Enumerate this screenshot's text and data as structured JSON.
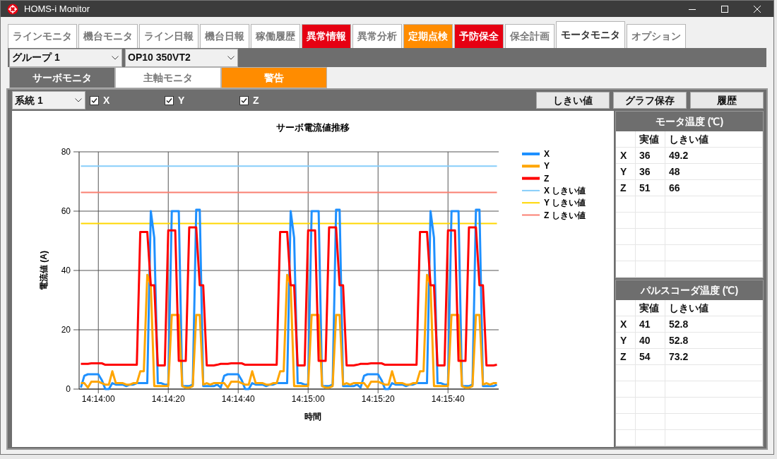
{
  "window": {
    "title": "HOMS-i Monitor"
  },
  "tabs": [
    {
      "label": "ラインモニタ",
      "kind": "normal",
      "selected": false
    },
    {
      "label": "機台モニタ",
      "kind": "normal",
      "selected": false
    },
    {
      "label": "ライン日報",
      "kind": "normal",
      "selected": false
    },
    {
      "label": "機台日報",
      "kind": "normal",
      "selected": false
    },
    {
      "label": "稼働履歴",
      "kind": "normal",
      "selected": false
    },
    {
      "label": "異常情報",
      "kind": "alert",
      "selected": false
    },
    {
      "label": "異常分析",
      "kind": "normal",
      "selected": false
    },
    {
      "label": "定期点検",
      "kind": "warning",
      "selected": false
    },
    {
      "label": "予防保全",
      "kind": "alert",
      "selected": false
    },
    {
      "label": "保全計画",
      "kind": "normal",
      "selected": false
    },
    {
      "label": "モータモニタ",
      "kind": "normal",
      "selected": true
    },
    {
      "label": "オプション",
      "kind": "normal",
      "selected": false
    }
  ],
  "selectors": [
    {
      "value": "グループ 1"
    },
    {
      "value": "OP10 350VT2"
    }
  ],
  "sub_tabs": [
    {
      "label": "サーボモニタ",
      "kind": "normal",
      "selected": true
    },
    {
      "label": "主軸モニタ",
      "kind": "normal",
      "selected": false
    },
    {
      "label": "警告",
      "kind": "warning",
      "selected": false
    }
  ],
  "toolbar": {
    "system_select": "系統 1",
    "axes": [
      {
        "label": "X",
        "checked": true
      },
      {
        "label": "Y",
        "checked": true
      },
      {
        "label": "Z",
        "checked": true
      }
    ],
    "buttons": [
      "しきい値",
      "グラフ保存",
      "履歴"
    ]
  },
  "chart": {
    "chart_data": {
      "type": "line",
      "title": "サーボ電流値推移",
      "xlabel": "時間",
      "ylabel": "電流値 (A)",
      "categories": [
        null,
        null,
        null,
        null,
        null,
        "14:14:00",
        null,
        null,
        null,
        null,
        null,
        null,
        null,
        null,
        null,
        null,
        null,
        null,
        null,
        null,
        null,
        null,
        null,
        null,
        null,
        "14:14:20",
        null,
        null,
        null,
        null,
        null,
        null,
        null,
        null,
        null,
        null,
        null,
        null,
        null,
        null,
        null,
        null,
        null,
        null,
        null,
        "14:14:40",
        null,
        null,
        null,
        null,
        null,
        null,
        null,
        null,
        null,
        null,
        null,
        null,
        null,
        null,
        null,
        null,
        null,
        null,
        null,
        "14:15:00",
        null,
        null,
        null,
        null,
        null,
        null,
        null,
        null,
        null,
        null,
        null,
        null,
        null,
        null,
        null,
        null,
        null,
        null,
        null,
        "14:15:20",
        null,
        null,
        null,
        null,
        null,
        null,
        null,
        null,
        null,
        null,
        null,
        null,
        null,
        null,
        null,
        null,
        null,
        null,
        null,
        "14:15:40",
        null,
        null,
        null,
        null,
        null,
        null,
        null,
        null,
        null,
        null,
        null,
        null,
        null,
        null
      ],
      "series": [
        {
          "name": "X",
          "color": "#1e90ff",
          "values": [
            0.5,
            4.5,
            5,
            5,
            5,
            5,
            3,
            0,
            0,
            2,
            1.5,
            1.5,
            1.5,
            1,
            1.5,
            1.5,
            2,
            2,
            2,
            2,
            60,
            51,
            2,
            2,
            1.5,
            1.5,
            60,
            60,
            60,
            1,
            1,
            1,
            1.5,
            60.5,
            60.5,
            1,
            1,
            1,
            1,
            1.5,
            0.5,
            4.5,
            5,
            5,
            5,
            5,
            3,
            0,
            0,
            2,
            1.5,
            1.5,
            1.5,
            1,
            1.5,
            1.5,
            2,
            2,
            2,
            2,
            60,
            51,
            2,
            2,
            1.5,
            1.5,
            60,
            60,
            60,
            1,
            1,
            1,
            1.5,
            60.5,
            60.5,
            1,
            1,
            1,
            1,
            1.5,
            0.5,
            4.5,
            5,
            5,
            5,
            5,
            3,
            0,
            0,
            2,
            1.5,
            1.5,
            1.5,
            1,
            1.5,
            1.5,
            2,
            2,
            2,
            2,
            60,
            51,
            2,
            2,
            1.5,
            1.5,
            60,
            60,
            60,
            1,
            1,
            1,
            1.5,
            60.5,
            60.5,
            1,
            1,
            1,
            1,
            1.5
          ]
        },
        {
          "name": "Y",
          "color": "#ffa500",
          "values": [
            2,
            2,
            0.5,
            2.5,
            2.5,
            2.5,
            2,
            1.5,
            1.5,
            6,
            2,
            2,
            2,
            1.5,
            1.5,
            2,
            2,
            6,
            6,
            38.5,
            35,
            1,
            1,
            1,
            1,
            1,
            25,
            25,
            25,
            1,
            0.5,
            0.5,
            1,
            25,
            25,
            1.5,
            2,
            1.5,
            2,
            2,
            2,
            2,
            0.5,
            2.5,
            2.5,
            2.5,
            2,
            1.5,
            1.5,
            6,
            2,
            2,
            2,
            1.5,
            1.5,
            2,
            2,
            6,
            6,
            38.5,
            35,
            1,
            1,
            1,
            1,
            1,
            25,
            25,
            25,
            1,
            0.5,
            0.5,
            1,
            25,
            25,
            1.5,
            2,
            1.5,
            2,
            2,
            2,
            2,
            0.5,
            2.5,
            2.5,
            2.5,
            2,
            1.5,
            1.5,
            6,
            2,
            2,
            2,
            1.5,
            1.5,
            2,
            2,
            6,
            6,
            38.5,
            35,
            1,
            1,
            1,
            1,
            1,
            25,
            25,
            25,
            1,
            0.5,
            0.5,
            1,
            25,
            25,
            1.5,
            2,
            1.5,
            2,
            2
          ]
        },
        {
          "name": "Z",
          "color": "#ff0000",
          "values": [
            8.5,
            8.5,
            8.5,
            8.7,
            8.7,
            8.7,
            8.7,
            8.2,
            8.2,
            8.2,
            8.2,
            8.2,
            8.2,
            8.2,
            8.2,
            8.2,
            8.2,
            53,
            53,
            53,
            35,
            35,
            8,
            8,
            8,
            53.5,
            53.5,
            53.5,
            9.5,
            9.5,
            9.5,
            54.5,
            54.5,
            54.5,
            35,
            35,
            8,
            8,
            8,
            8.2,
            8.5,
            8.5,
            8.5,
            8.7,
            8.7,
            8.7,
            8.7,
            8.2,
            8.2,
            8.2,
            8.2,
            8.2,
            8.2,
            8.2,
            8.2,
            8.2,
            8.2,
            53,
            53,
            53,
            35,
            35,
            8,
            8,
            8,
            53.5,
            53.5,
            53.5,
            9.5,
            9.5,
            9.5,
            54.5,
            54.5,
            54.5,
            35,
            35,
            8,
            8,
            8,
            8.2,
            8.5,
            8.5,
            8.5,
            8.7,
            8.7,
            8.7,
            8.7,
            8.2,
            8.2,
            8.2,
            8.2,
            8.2,
            8.2,
            8.2,
            8.2,
            8.2,
            8.2,
            53,
            53,
            53,
            35,
            35,
            8,
            8,
            8,
            53.5,
            53.5,
            53.5,
            9.5,
            9.5,
            9.5,
            54.5,
            54.5,
            54.5,
            35,
            35,
            8,
            8,
            8,
            8.2
          ]
        },
        {
          "name": "X しきい値",
          "color": "#87cefa",
          "values": [
            75.2,
            75.2,
            75.2,
            75.2,
            75.2,
            75.2,
            75.2,
            75.2,
            75.2,
            75.2,
            75.2,
            75.2,
            75.2,
            75.2,
            75.2,
            75.2,
            75.2,
            75.2,
            75.2,
            75.2,
            75.2,
            75.2,
            75.2,
            75.2,
            75.2,
            75.2,
            75.2,
            75.2,
            75.2,
            75.2,
            75.2,
            75.2,
            75.2,
            75.2,
            75.2,
            75.2,
            75.2,
            75.2,
            75.2,
            75.2,
            75.2,
            75.2,
            75.2,
            75.2,
            75.2,
            75.2,
            75.2,
            75.2,
            75.2,
            75.2,
            75.2,
            75.2,
            75.2,
            75.2,
            75.2,
            75.2,
            75.2,
            75.2,
            75.2,
            75.2,
            75.2,
            75.2,
            75.2,
            75.2,
            75.2,
            75.2,
            75.2,
            75.2,
            75.2,
            75.2,
            75.2,
            75.2,
            75.2,
            75.2,
            75.2,
            75.2,
            75.2,
            75.2,
            75.2,
            75.2,
            75.2,
            75.2,
            75.2,
            75.2,
            75.2,
            75.2,
            75.2,
            75.2,
            75.2,
            75.2,
            75.2,
            75.2,
            75.2,
            75.2,
            75.2,
            75.2,
            75.2,
            75.2,
            75.2,
            75.2,
            75.2,
            75.2,
            75.2,
            75.2,
            75.2,
            75.2,
            75.2,
            75.2,
            75.2,
            75.2,
            75.2,
            75.2,
            75.2,
            75.2,
            75.2,
            75.2,
            75.2,
            75.2,
            75.2,
            75.2
          ]
        },
        {
          "name": "Y しきい値",
          "color": "#ffd700",
          "values": [
            55.8,
            55.8,
            55.8,
            55.8,
            55.8,
            55.8,
            55.8,
            55.8,
            55.8,
            55.8,
            55.8,
            55.8,
            55.8,
            55.8,
            55.8,
            55.8,
            55.8,
            55.8,
            55.8,
            55.8,
            55.8,
            55.8,
            55.8,
            55.8,
            55.8,
            55.8,
            55.8,
            55.8,
            55.8,
            55.8,
            55.8,
            55.8,
            55.8,
            55.8,
            55.8,
            55.8,
            55.8,
            55.8,
            55.8,
            55.8,
            55.8,
            55.8,
            55.8,
            55.8,
            55.8,
            55.8,
            55.8,
            55.8,
            55.8,
            55.8,
            55.8,
            55.8,
            55.8,
            55.8,
            55.8,
            55.8,
            55.8,
            55.8,
            55.8,
            55.8,
            55.8,
            55.8,
            55.8,
            55.8,
            55.8,
            55.8,
            55.8,
            55.8,
            55.8,
            55.8,
            55.8,
            55.8,
            55.8,
            55.8,
            55.8,
            55.8,
            55.8,
            55.8,
            55.8,
            55.8,
            55.8,
            55.8,
            55.8,
            55.8,
            55.8,
            55.8,
            55.8,
            55.8,
            55.8,
            55.8,
            55.8,
            55.8,
            55.8,
            55.8,
            55.8,
            55.8,
            55.8,
            55.8,
            55.8,
            55.8,
            55.8,
            55.8,
            55.8,
            55.8,
            55.8,
            55.8,
            55.8,
            55.8,
            55.8,
            55.8,
            55.8,
            55.8,
            55.8,
            55.8,
            55.8,
            55.8,
            55.8,
            55.8,
            55.8,
            55.8
          ]
        },
        {
          "name": "Z しきい値",
          "color": "#fa8072",
          "values": [
            66.3,
            66.3,
            66.3,
            66.3,
            66.3,
            66.3,
            66.3,
            66.3,
            66.3,
            66.3,
            66.3,
            66.3,
            66.3,
            66.3,
            66.3,
            66.3,
            66.3,
            66.3,
            66.3,
            66.3,
            66.3,
            66.3,
            66.3,
            66.3,
            66.3,
            66.3,
            66.3,
            66.3,
            66.3,
            66.3,
            66.3,
            66.3,
            66.3,
            66.3,
            66.3,
            66.3,
            66.3,
            66.3,
            66.3,
            66.3,
            66.3,
            66.3,
            66.3,
            66.3,
            66.3,
            66.3,
            66.3,
            66.3,
            66.3,
            66.3,
            66.3,
            66.3,
            66.3,
            66.3,
            66.3,
            66.3,
            66.3,
            66.3,
            66.3,
            66.3,
            66.3,
            66.3,
            66.3,
            66.3,
            66.3,
            66.3,
            66.3,
            66.3,
            66.3,
            66.3,
            66.3,
            66.3,
            66.3,
            66.3,
            66.3,
            66.3,
            66.3,
            66.3,
            66.3,
            66.3,
            66.3,
            66.3,
            66.3,
            66.3,
            66.3,
            66.3,
            66.3,
            66.3,
            66.3,
            66.3,
            66.3,
            66.3,
            66.3,
            66.3,
            66.3,
            66.3,
            66.3,
            66.3,
            66.3,
            66.3,
            66.3,
            66.3,
            66.3,
            66.3,
            66.3,
            66.3,
            66.3,
            66.3,
            66.3,
            66.3,
            66.3,
            66.3,
            66.3,
            66.3,
            66.3,
            66.3,
            66.3,
            66.3,
            66.3,
            66.3
          ]
        }
      ],
      "ylim": [
        0,
        80
      ],
      "grid": true,
      "legend": true,
      "yticks": [
        0,
        20,
        40,
        60,
        80
      ]
    }
  },
  "temperature_tables": [
    {
      "title": "モータ温度 (℃)",
      "columns": [
        "実値",
        "しきい値"
      ],
      "rows": [
        {
          "axis": "X",
          "values": [
            "36",
            "49.2"
          ]
        },
        {
          "axis": "Y",
          "values": [
            "36",
            "48"
          ]
        },
        {
          "axis": "Z",
          "values": [
            "51",
            "66"
          ]
        }
      ]
    },
    {
      "title": "パルスコーダ温度 (℃)",
      "columns": [
        "実値",
        "しきい値"
      ],
      "rows": [
        {
          "axis": "X",
          "values": [
            "41",
            "52.8"
          ]
        },
        {
          "axis": "Y",
          "values": [
            "40",
            "52.8"
          ]
        },
        {
          "axis": "Z",
          "values": [
            "54",
            "73.2"
          ]
        }
      ]
    }
  ]
}
